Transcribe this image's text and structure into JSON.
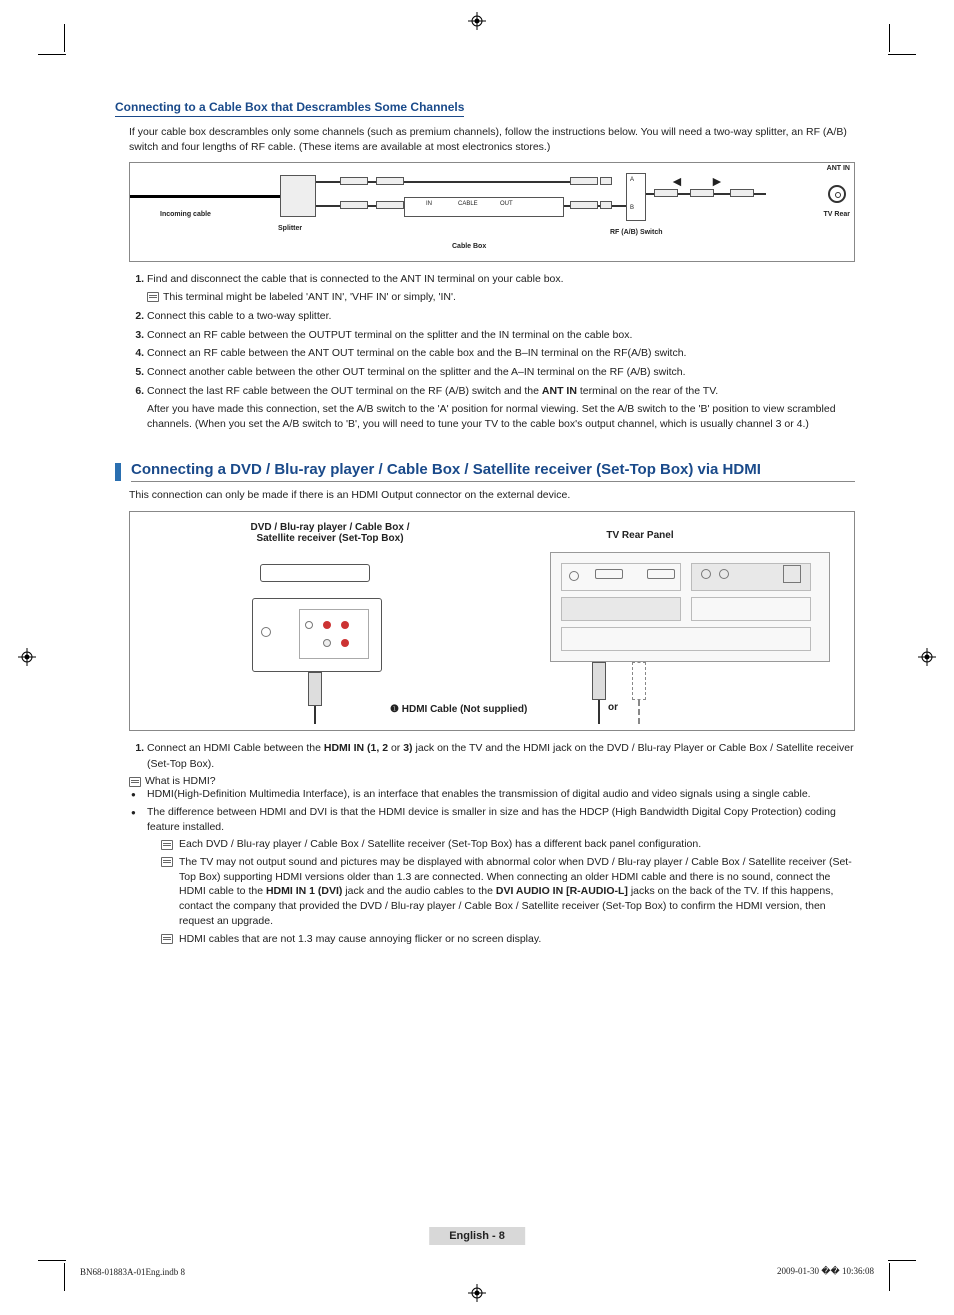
{
  "section1": {
    "title": "Connecting to a Cable Box that Descrambles Some Channels",
    "intro": "If your cable box descrambles only some channels (such as premium channels), follow the instructions below. You will need a two-way splitter, an RF (A/B) switch and four lengths of RF cable. (These items are available at most electronics stores.)",
    "diagram": {
      "incoming": "Incoming cable",
      "splitter": "Splitter",
      "cable_box": "Cable Box",
      "in": "IN",
      "cable": "CABLE",
      "out": "OUT",
      "rf_switch": "RF (A/B) Switch",
      "a": "A",
      "b": "B",
      "ant_in": "ANT IN",
      "tv_rear": "TV Rear"
    },
    "steps": [
      {
        "text": "Find and disconnect the cable that is connected to the ANT IN terminal on your cable box.",
        "note": "This terminal might be labeled 'ANT IN', 'VHF IN' or simply, 'IN'."
      },
      {
        "text": "Connect this cable to a two-way splitter."
      },
      {
        "text": "Connect an RF cable between the OUTPUT terminal on the splitter and the IN terminal on the cable box."
      },
      {
        "text": "Connect an RF cable between the ANT OUT terminal on the cable box and the B–IN terminal on the RF(A/B) switch."
      },
      {
        "text": "Connect another cable between the other OUT terminal on the splitter and the A–IN terminal on the RF (A/B) switch."
      },
      {
        "text_pre": "Connect the last RF cable between the OUT terminal on the RF (A/B) switch and the ",
        "bold1": "ANT IN",
        "text_post": " terminal on the rear of the TV.",
        "after": "After you have made this connection, set the A/B switch to the 'A' position for normal viewing. Set the A/B switch to the 'B' position to view scrambled channels. (When you set the A/B switch to 'B', you will need to tune your TV to the cable box's output channel, which is usually channel 3 or 4.)"
      }
    ]
  },
  "section2": {
    "title": "Connecting a DVD / Blu-ray player / Cable Box / Satellite receiver (Set-Top Box) via HDMI",
    "intro": "This connection can only be made if there is an HDMI Output connector on the external device.",
    "diagram": {
      "left_label": "DVD / Blu-ray player / Cable Box /\nSatellite receiver (Set-Top Box)",
      "right_label": "TV Rear Panel",
      "num": "❶",
      "hdmi_label": "HDMI Cable (Not supplied)",
      "or": "or"
    },
    "step1_pre": "Connect an HDMI Cable between the ",
    "step1_b1": "HDMI IN (1, 2",
    "step1_mid": " or ",
    "step1_b2": "3)",
    "step1_post": " jack on the TV and the HDMI jack on the DVD / Blu-ray Player or Cable Box / Satellite receiver (Set-Top Box).",
    "note1": "What is HDMI?",
    "bullet1": "HDMI(High-Definition Multimedia Interface), is an interface that enables the transmission of digital audio and video signals using a single cable.",
    "bullet2": "The difference between HDMI and DVI is that the HDMI device is smaller in size and has the HDCP (High Bandwidth Digital Copy Protection) coding feature installed.",
    "subnote1": "Each DVD / Blu-ray player / Cable Box / Satellite receiver (Set-Top Box) has a different back panel configuration.",
    "subnote2_pre": "The TV may not output sound and pictures may be displayed with abnormal color when DVD / Blu-ray player / Cable Box / Satellite receiver (Set-Top Box) supporting HDMI versions older than 1.3 are connected. When connecting an older HDMI cable and there is no sound, connect the HDMI cable to the ",
    "subnote2_b1": "HDMI IN 1 (DVI)",
    "subnote2_mid": " jack and the audio cables to the ",
    "subnote2_b2": "DVI AUDIO IN [R-AUDIO-L]",
    "subnote2_post": " jacks on the back of the TV. If this happens, contact the company that provided the DVD / Blu-ray player / Cable Box / Satellite receiver (Set-Top Box) to confirm the HDMI version, then request an upgrade.",
    "subnote3": "HDMI cables that are not 1.3 may cause annoying flicker or no screen display."
  },
  "page_number": "English - 8",
  "footer_left": "BN68-01883A-01Eng.indb   8",
  "footer_right": "2009-01-30   �� 10:36:08"
}
